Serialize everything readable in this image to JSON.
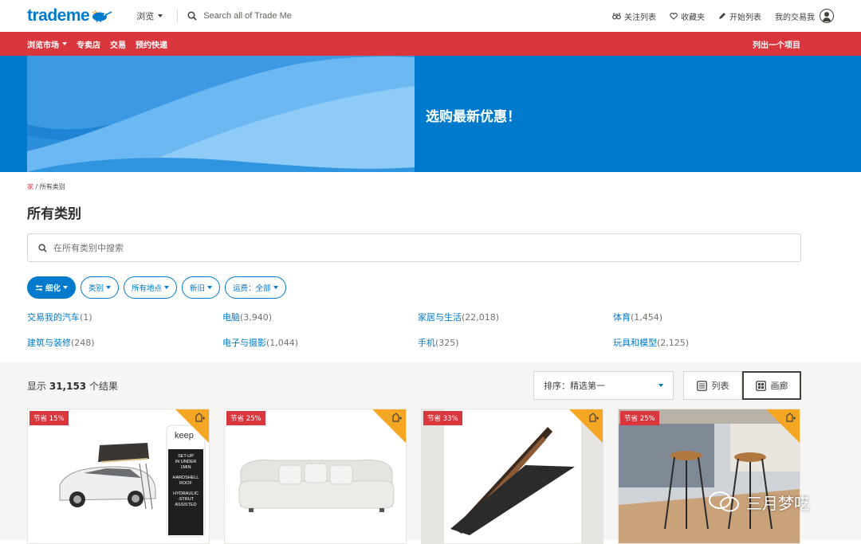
{
  "header": {
    "logo": "trademe",
    "browse": "浏览",
    "search_placeholder": "Search all of Trade Me",
    "watchlist": "关注列表",
    "favourites": "收藏夹",
    "start_listing": "开始列表",
    "my_trade_me": "我的交易我"
  },
  "nav": {
    "items": [
      "浏览市场",
      "专卖店",
      "交易",
      "预约快递"
    ],
    "list_item": "列出一个项目"
  },
  "hero": {
    "text": "选购最新优惠！"
  },
  "breadcrumb": {
    "home": "家",
    "sep": " / ",
    "current": "所有类别"
  },
  "page_title": "所有类别",
  "search": {
    "placeholder": "在所有类别中搜索"
  },
  "filters": [
    {
      "label": "细化"
    },
    {
      "label": "类别"
    },
    {
      "label": "所有地点"
    },
    {
      "label": "新旧"
    },
    {
      "label": "运费：全部"
    }
  ],
  "categories": [
    {
      "name": "交易我的汽车",
      "count": "(1)"
    },
    {
      "name": "电脑",
      "count": "(3,940)"
    },
    {
      "name": "家居与生活",
      "count": "(22,018)"
    },
    {
      "name": "体育",
      "count": "(1,454)"
    },
    {
      "name": "建筑与装修",
      "count": "(248)"
    },
    {
      "name": "电子与摄影",
      "count": "(1,044)"
    },
    {
      "name": "手机",
      "count": "(325)"
    },
    {
      "name": "玩具和模型",
      "count": "(2,125)"
    }
  ],
  "results": {
    "prefix": "显示",
    "count": "31,153",
    "suffix": "个结果",
    "sort_label": "排序：精选第一",
    "view_list": "列表",
    "view_gallery": "画廊"
  },
  "cards": [
    {
      "badge": "节省 15%",
      "keep_logo": "keep",
      "keep_lines": [
        "SET-UP",
        "IN UNDER",
        "1MIN",
        "HARDSHELL",
        "ROOF",
        "HYDRAULIC",
        "-STRUT",
        "ASSISTED"
      ]
    },
    {
      "badge": "节省 25%"
    },
    {
      "badge": "节省 33%"
    },
    {
      "badge": "节省 25%"
    }
  ],
  "watermark": "三月梦呓",
  "colors": {
    "brand_blue": "#007acd",
    "nav_red": "#d9363e",
    "hero_blue": "#007acd",
    "save_corner": "#f5a623"
  }
}
